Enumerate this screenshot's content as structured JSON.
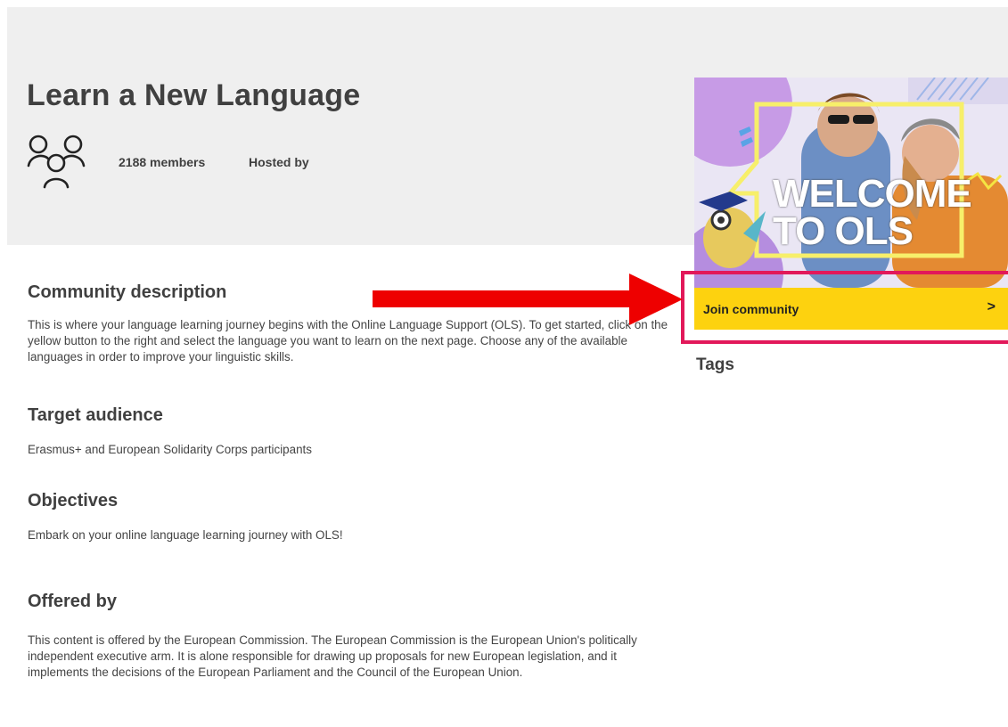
{
  "header": {
    "title": "Learn a New Language",
    "members": "2188 members",
    "hosted_by": "Hosted by"
  },
  "sections": {
    "description": {
      "heading": "Community description",
      "text": "This is where your language learning journey begins with the Online Language Support (OLS). To get started, click on the yellow button to the right and select the language you want to learn on the next page. Choose any of the available languages in order to improve your linguistic skills."
    },
    "audience": {
      "heading": "Target audience",
      "text": "Erasmus+ and European Solidarity Corps participants"
    },
    "objectives": {
      "heading": "Objectives",
      "text": "Embark on your online language learning journey with OLS!"
    },
    "offered_by": {
      "heading": "Offered by",
      "text": "This content is offered by the European Commission. The European Commission is the European Union's politically independent executive arm. It is alone responsible for drawing up proposals for new European legislation, and it implements the decisions of the European Parliament and the Council of the European Union."
    }
  },
  "sidebar": {
    "banner_line1": "WELCOME",
    "banner_line2": "TO OLS",
    "join_label": "Join community",
    "join_chevron": ">",
    "tags_heading": "Tags"
  },
  "colors": {
    "join_button": "#fdd20f",
    "highlight_box": "#e2185a",
    "annotation_arrow": "#ee0000",
    "header_band": "#efefef"
  }
}
